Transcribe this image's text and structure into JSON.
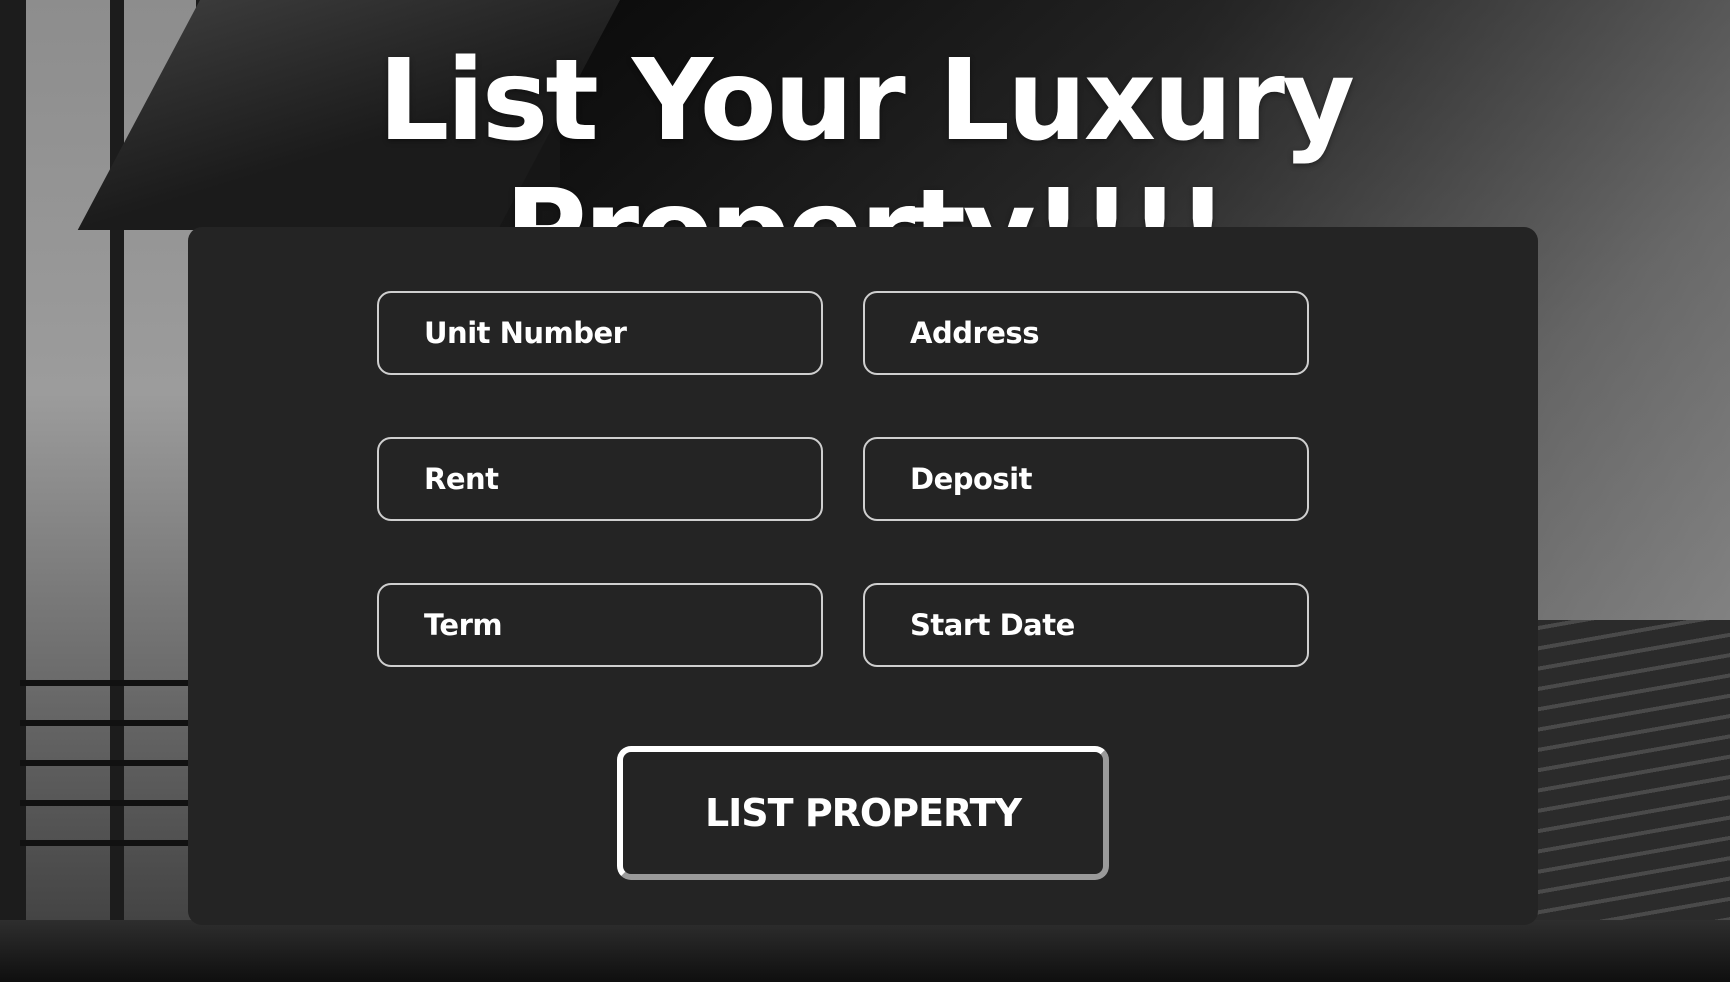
{
  "page": {
    "title": "List Your Luxury Property!!!!"
  },
  "form": {
    "fields": [
      {
        "placeholder": "Unit Number",
        "value": ""
      },
      {
        "placeholder": "Address",
        "value": ""
      },
      {
        "placeholder": "Rent",
        "value": ""
      },
      {
        "placeholder": "Deposit",
        "value": ""
      },
      {
        "placeholder": "Term",
        "value": ""
      },
      {
        "placeholder": "Start Date",
        "value": ""
      }
    ],
    "submit_label": "LIST PROPERTY"
  },
  "colors": {
    "panel_background": "#242424",
    "field_border": "#cfcfcf",
    "text": "#ffffff"
  }
}
